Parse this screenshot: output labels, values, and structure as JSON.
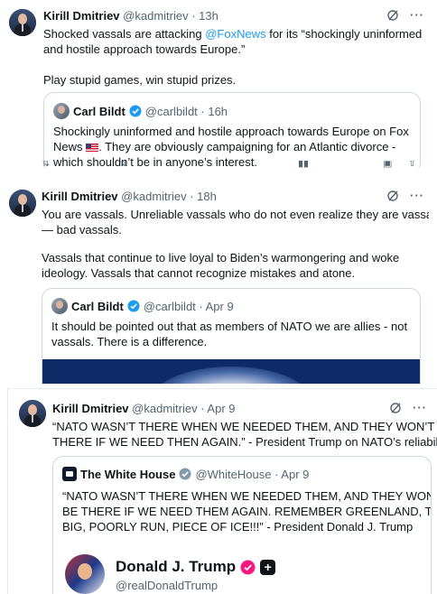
{
  "tweets": [
    {
      "author_name": "Kirill Dmitriev",
      "author_meta": "@kadmitriev · 13h",
      "line1_pre": "Shocked vassals are attacking ",
      "line1_link": "@FoxNews",
      "line1_post": " for its “shockingly uninformed",
      "line2": "and hostile approach towards Europe.”",
      "line3": "Play stupid games, win stupid prizes.",
      "quote": {
        "author_name": "Carl Bildt",
        "author_meta": "@carlbildt · 16h",
        "line1": "Shockingly uninformed and hostile approach towards Europe on Fox",
        "line2_pre": "News ",
        "line2_post": ". They are obviously campaigning for an Atlantic divorce -",
        "line3": "which shouldn’t be in anyone’s interest."
      }
    },
    {
      "author_name": "Kirill Dmitriev",
      "author_meta": "@kadmitriev · 18h",
      "line1": "You are vassals. Unreliable vassals who do not even realize they are vassals",
      "line2": "— bad vassals.",
      "line3": "Vassals that continue to live loyal to Biden’s warmongering and woke",
      "line4": "ideology. Vassals that cannot recognize mistakes and atone.",
      "quote": {
        "author_name": "Carl Bildt",
        "author_meta": "@carlbildt · Apr 9",
        "line1": "It should be pointed out that as members of NATO we are allies - not",
        "line2": "vassals. There is a difference."
      }
    },
    {
      "author_name": "Kirill Dmitriev",
      "author_meta": "@kadmitriev · Apr 9",
      "line1": "“NATO WASN’T THERE WHEN WE NEEDED THEM, AND THEY WON’T BE",
      "line2": "THERE IF WE NEED THEN AGAIN.” - President Trump on NATO’s reliability.",
      "quote": {
        "author_name": "The White House",
        "author_meta": "@WhiteHouse · Apr 9",
        "line1": "“NATO WASN’T THERE WHEN WE NEEDED THEM, AND THEY WON’T",
        "line2": "BE THERE IF WE NEED THEM AGAIN. REMEMBER GREENLAND, THAT",
        "line3": "BIG, POORLY RUN, PIECE OF ICE!!!” - President Donald J. Trump",
        "embed_name": "Donald J. Trump",
        "embed_handle": "@realDonaldTrump"
      }
    }
  ],
  "more_glyph": "···",
  "colors": {
    "link": "#1d9bf0",
    "muted": "#536471",
    "border": "#cfd9de",
    "verified_blue": "#1d9bf0",
    "verified_gray": "#829aab",
    "badge_red": "#f91880"
  }
}
